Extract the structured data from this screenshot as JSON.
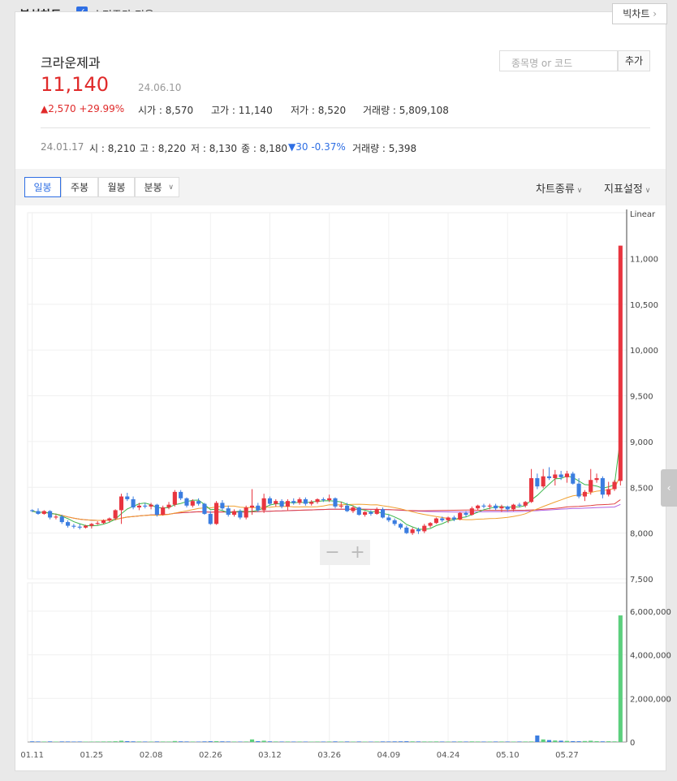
{
  "header": {
    "title": "분석차트",
    "adjusted_label": "수정주가 적용",
    "big_chart_label": "빅차트",
    "big_chart_arrow": "›"
  },
  "stock": {
    "name": "크라운제과",
    "price": "11,140",
    "date": "24.06.10",
    "change": "▲2,570 +29.99%",
    "open": "시가 : 8,570",
    "high": "고가 : 11,140",
    "low": "저가 : 8,520",
    "volume": "거래량 : 5,809,108"
  },
  "search": {
    "placeholder": "종목명 or 코드",
    "add_label": "추가"
  },
  "hover_day": {
    "date": "24.01.17",
    "open": "시 : 8,210",
    "high": "고 : 8,220",
    "low": "저 : 8,130",
    "close": "종 : 8,180",
    "change": "▼30 -0.37%",
    "volume": "거래량 : 5,398"
  },
  "toolbar": {
    "tabs": [
      "일봉",
      "주봉",
      "월봉",
      "분봉"
    ],
    "chart_type": "차트종류",
    "indicator": "지표설정"
  },
  "zoom": {
    "minus": "−",
    "plus": "+"
  },
  "colors": {
    "up": "#e8353f",
    "down": "#3b7de0",
    "vol_up": "#5ccf7d",
    "vol_down": "#3b7de0",
    "ma5": "#3ab54a",
    "ma20": "#f0a030",
    "ma60": "#e04040",
    "ma120": "#b060e0"
  },
  "chart_data": {
    "type": "candlestick",
    "scale_label": "Linear",
    "y_ticks": [
      "11,000",
      "10,500",
      "10,000",
      "9,500",
      "9,000",
      "8,500",
      "8,000",
      "7,500"
    ],
    "y_tick_values": [
      11000,
      10500,
      10000,
      9500,
      9000,
      8500,
      8000,
      7500
    ],
    "ylim": [
      7500,
      11500
    ],
    "vol_ticks": [
      "6,000,000",
      "4,000,000",
      "2,000,000",
      "0"
    ],
    "vol_tick_values": [
      6000000,
      4000000,
      2000000,
      0
    ],
    "vol_ylim": [
      0,
      7300000
    ],
    "x_ticks": [
      "01.11",
      "01.25",
      "02.08",
      "02.26",
      "03.12",
      "03.26",
      "04.09",
      "04.24",
      "05.10",
      "05.27"
    ],
    "x_tick_index": [
      0,
      10,
      20,
      30,
      40,
      50,
      60,
      70,
      80,
      90
    ],
    "candles": [
      [
        8250,
        8260,
        8230,
        8240
      ],
      [
        8240,
        8270,
        8200,
        8210
      ],
      [
        8210,
        8250,
        8200,
        8240
      ],
      [
        8240,
        8250,
        8150,
        8170
      ],
      [
        8170,
        8200,
        8150,
        8180
      ],
      [
        8180,
        8200,
        8100,
        8120
      ],
      [
        8120,
        8140,
        8060,
        8080
      ],
      [
        8080,
        8100,
        8050,
        8070
      ],
      [
        8070,
        8100,
        8040,
        8060
      ],
      [
        8060,
        8090,
        8050,
        8080
      ],
      [
        8080,
        8110,
        8050,
        8100
      ],
      [
        8100,
        8130,
        8090,
        8110
      ],
      [
        8110,
        8150,
        8100,
        8140
      ],
      [
        8140,
        8170,
        8120,
        8160
      ],
      [
        8160,
        8260,
        8140,
        8250
      ],
      [
        8250,
        8430,
        8100,
        8400
      ],
      [
        8400,
        8440,
        8350,
        8370
      ],
      [
        8370,
        8400,
        8260,
        8280
      ],
      [
        8280,
        8330,
        8250,
        8300
      ],
      [
        8300,
        8330,
        8270,
        8290
      ],
      [
        8290,
        8330,
        8260,
        8310
      ],
      [
        8310,
        8320,
        8180,
        8200
      ],
      [
        8200,
        8300,
        8190,
        8280
      ],
      [
        8280,
        8340,
        8260,
        8310
      ],
      [
        8310,
        8470,
        8290,
        8450
      ],
      [
        8450,
        8470,
        8360,
        8380
      ],
      [
        8380,
        8390,
        8280,
        8300
      ],
      [
        8300,
        8370,
        8280,
        8350
      ],
      [
        8350,
        8380,
        8300,
        8320
      ],
      [
        8320,
        8330,
        8200,
        8210
      ],
      [
        8210,
        8240,
        8090,
        8100
      ],
      [
        8100,
        8350,
        8090,
        8330
      ],
      [
        8330,
        8360,
        8250,
        8270
      ],
      [
        8270,
        8300,
        8180,
        8200
      ],
      [
        8200,
        8260,
        8180,
        8240
      ],
      [
        8240,
        8260,
        8150,
        8170
      ],
      [
        8170,
        8300,
        8150,
        8280
      ],
      [
        8280,
        8480,
        8200,
        8300
      ],
      [
        8300,
        8330,
        8230,
        8250
      ],
      [
        8250,
        8430,
        8220,
        8380
      ],
      [
        8380,
        8400,
        8300,
        8320
      ],
      [
        8320,
        8370,
        8290,
        8350
      ],
      [
        8350,
        8370,
        8270,
        8290
      ],
      [
        8290,
        8370,
        8250,
        8350
      ],
      [
        8350,
        8380,
        8310,
        8330
      ],
      [
        8330,
        8390,
        8310,
        8370
      ],
      [
        8370,
        8390,
        8300,
        8320
      ],
      [
        8320,
        8360,
        8300,
        8340
      ],
      [
        8340,
        8380,
        8320,
        8370
      ],
      [
        8370,
        8390,
        8340,
        8360
      ],
      [
        8360,
        8420,
        8340,
        8380
      ],
      [
        8380,
        8390,
        8270,
        8290
      ],
      [
        8290,
        8340,
        8270,
        8300
      ],
      [
        8300,
        8330,
        8230,
        8240
      ],
      [
        8240,
        8300,
        8220,
        8280
      ],
      [
        8280,
        8290,
        8190,
        8200
      ],
      [
        8200,
        8240,
        8180,
        8230
      ],
      [
        8230,
        8250,
        8190,
        8210
      ],
      [
        8210,
        8280,
        8200,
        8260
      ],
      [
        8260,
        8280,
        8160,
        8170
      ],
      [
        8170,
        8200,
        8120,
        8140
      ],
      [
        8140,
        8160,
        8080,
        8100
      ],
      [
        8100,
        8110,
        8040,
        8060
      ],
      [
        8060,
        8080,
        7990,
        8000
      ],
      [
        8000,
        8060,
        7980,
        8040
      ],
      [
        8040,
        8060,
        7990,
        8020
      ],
      [
        8020,
        8100,
        8000,
        8080
      ],
      [
        8080,
        8120,
        8060,
        8110
      ],
      [
        8110,
        8170,
        8100,
        8160
      ],
      [
        8160,
        8180,
        8120,
        8140
      ],
      [
        8140,
        8180,
        8110,
        8170
      ],
      [
        8170,
        8190,
        8130,
        8150
      ],
      [
        8150,
        8230,
        8140,
        8220
      ],
      [
        8220,
        8240,
        8180,
        8200
      ],
      [
        8200,
        8290,
        8190,
        8270
      ],
      [
        8270,
        8310,
        8250,
        8300
      ],
      [
        8300,
        8320,
        8270,
        8290
      ],
      [
        8290,
        8320,
        8260,
        8300
      ],
      [
        8300,
        8320,
        8250,
        8270
      ],
      [
        8270,
        8310,
        8230,
        8290
      ],
      [
        8290,
        8300,
        8240,
        8260
      ],
      [
        8260,
        8320,
        8240,
        8310
      ],
      [
        8310,
        8330,
        8280,
        8300
      ],
      [
        8300,
        8350,
        8280,
        8340
      ],
      [
        8340,
        8700,
        8330,
        8600
      ],
      [
        8600,
        8650,
        8480,
        8510
      ],
      [
        8510,
        8700,
        8490,
        8620
      ],
      [
        8620,
        8720,
        8580,
        8600
      ],
      [
        8600,
        8690,
        8520,
        8640
      ],
      [
        8640,
        8680,
        8580,
        8610
      ],
      [
        8610,
        8680,
        8550,
        8650
      ],
      [
        8650,
        8670,
        8530,
        8540
      ],
      [
        8540,
        8600,
        8380,
        8400
      ],
      [
        8400,
        8470,
        8350,
        8450
      ],
      [
        8450,
        8700,
        8420,
        8580
      ],
      [
        8580,
        8650,
        8550,
        8600
      ],
      [
        8600,
        8620,
        8380,
        8420
      ],
      [
        8420,
        8560,
        8400,
        8480
      ],
      [
        8480,
        8580,
        8460,
        8560
      ],
      [
        8570,
        11140,
        8520,
        11140
      ]
    ],
    "volumes": [
      30000,
      25000,
      22000,
      28000,
      20000,
      26000,
      24000,
      21000,
      23000,
      19000,
      20000,
      22000,
      25000,
      27000,
      35000,
      60000,
      40000,
      30000,
      25000,
      22000,
      21000,
      26000,
      24000,
      22000,
      45000,
      30000,
      25000,
      22000,
      20000,
      28000,
      35000,
      40000,
      30000,
      25000,
      22000,
      20000,
      24000,
      120000,
      40000,
      60000,
      30000,
      25000,
      22000,
      24000,
      21000,
      23000,
      20000,
      19000,
      22000,
      21000,
      24000,
      28000,
      22000,
      25000,
      21000,
      24000,
      20000,
      19000,
      22000,
      26000,
      24000,
      28000,
      30000,
      35000,
      30000,
      26000,
      25000,
      24000,
      27000,
      22000,
      21000,
      23000,
      26000,
      22000,
      28000,
      24000,
      21000,
      22000,
      23000,
      24000,
      22000,
      21000,
      23000,
      24000,
      26000,
      300000,
      120000,
      90000,
      70000,
      60000,
      50000,
      40000,
      35000,
      45000,
      60000,
      40000,
      30000,
      35000,
      30000,
      5809108
    ]
  }
}
